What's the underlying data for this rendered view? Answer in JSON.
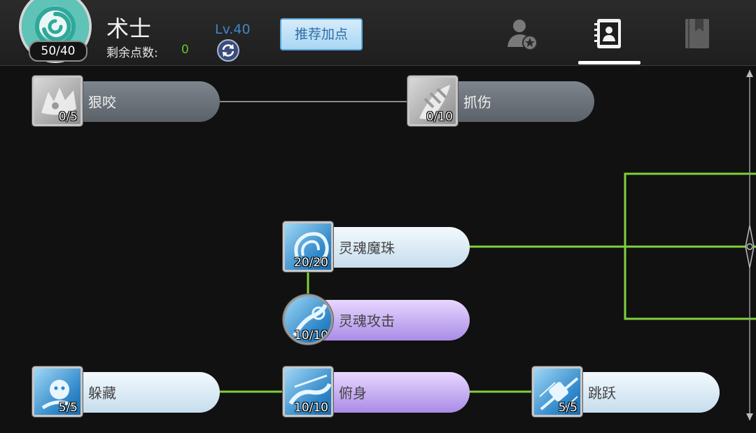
{
  "header": {
    "class_name": "术士",
    "points_used": "50/40",
    "remaining_label": "剩余点数:",
    "remaining_value": "0",
    "level": "Lv.40",
    "recommend_label": "推荐加点",
    "tabs": [
      {
        "icon": "character-star-icon",
        "active": false
      },
      {
        "icon": "skills-contact-book-icon",
        "active": true
      },
      {
        "icon": "bookmark-book-icon",
        "active": false
      }
    ]
  },
  "skills": [
    {
      "name": "狠咬",
      "level": "0/5",
      "state": "locked",
      "icon": "bite-icon"
    },
    {
      "name": "抓伤",
      "level": "0/10",
      "state": "locked",
      "icon": "claw-icon"
    },
    {
      "name": "灵魂魔珠",
      "level": "20/20",
      "state": "maxed",
      "icon": "soul-orb-icon"
    },
    {
      "name": "灵魂攻击",
      "level": "10/10",
      "state": "maxed-purple",
      "icon": "soul-strike-icon"
    },
    {
      "name": "躲藏",
      "level": "5/5",
      "state": "maxed",
      "icon": "hide-icon"
    },
    {
      "name": "俯身",
      "level": "10/10",
      "state": "maxed-purple",
      "icon": "crouch-icon"
    },
    {
      "name": "跳跃",
      "level": "5/5",
      "state": "maxed",
      "icon": "jump-icon"
    }
  ],
  "colors": {
    "active_connector": "#7fd13b",
    "locked_connector": "#8b8b8b",
    "remaining_points": "#62c32d",
    "level_text": "#3f86c8"
  }
}
